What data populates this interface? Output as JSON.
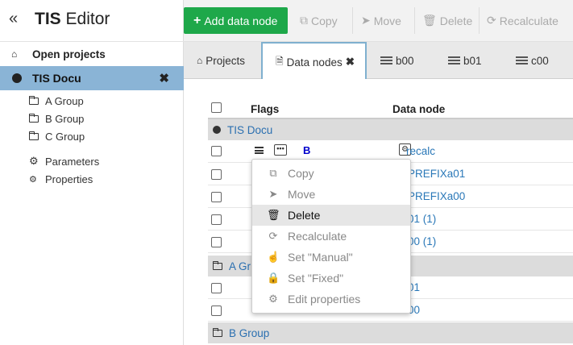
{
  "sidebar": {
    "collapse_glyph": "«",
    "app_title_bold": "TIS",
    "app_title_rest": " Editor",
    "open_projects": "Open projects",
    "selected_project": "TIS Docu",
    "tree": [
      {
        "label": "A Group",
        "icon": "folder-icon"
      },
      {
        "label": "B Group",
        "icon": "folder-icon"
      },
      {
        "label": "C Group",
        "icon": "folder-icon"
      },
      {
        "label": "Parameters",
        "icon": "gear-icon"
      },
      {
        "label": "Properties",
        "icon": "gears-icon"
      }
    ]
  },
  "toolbar": {
    "add": "Add data node",
    "copy": "Copy",
    "move": "Move",
    "delete": "Delete",
    "recalculate": "Recalculate",
    "add_color": "#1ea84a"
  },
  "tabs": [
    {
      "label": "Projects",
      "icon": "home-icon"
    },
    {
      "label": "Data nodes",
      "icon": "document-icon",
      "active": true
    },
    {
      "label": "b00",
      "icon": "database-icon"
    },
    {
      "label": "b01",
      "icon": "database-icon"
    },
    {
      "label": "c00",
      "icon": "database-icon"
    }
  ],
  "table": {
    "headers": {
      "flags": "Flags",
      "data_node": "Data node"
    },
    "group_tis": "TIS Docu",
    "flag_b": "B",
    "first_row_node": "recalc",
    "rows_tis": [
      "PREFIXa01",
      "PREFIXa00",
      "01 (1)",
      "00 (1)"
    ],
    "group_a": "A Gr",
    "rows_a": [
      "01",
      "00"
    ],
    "group_b": "B Group"
  },
  "context_menu": {
    "items": [
      {
        "label": "Copy",
        "icon": "copy-icon"
      },
      {
        "label": "Move",
        "icon": "send-icon"
      },
      {
        "label": "Delete",
        "icon": "trash-icon",
        "highlighted": true
      },
      {
        "label": "Recalculate",
        "icon": "refresh-icon"
      },
      {
        "label": "Set \"Manual\"",
        "icon": "hand-icon"
      },
      {
        "label": "Set \"Fixed\"",
        "icon": "lock-icon"
      },
      {
        "label": "Edit properties",
        "icon": "gears-icon"
      }
    ]
  }
}
